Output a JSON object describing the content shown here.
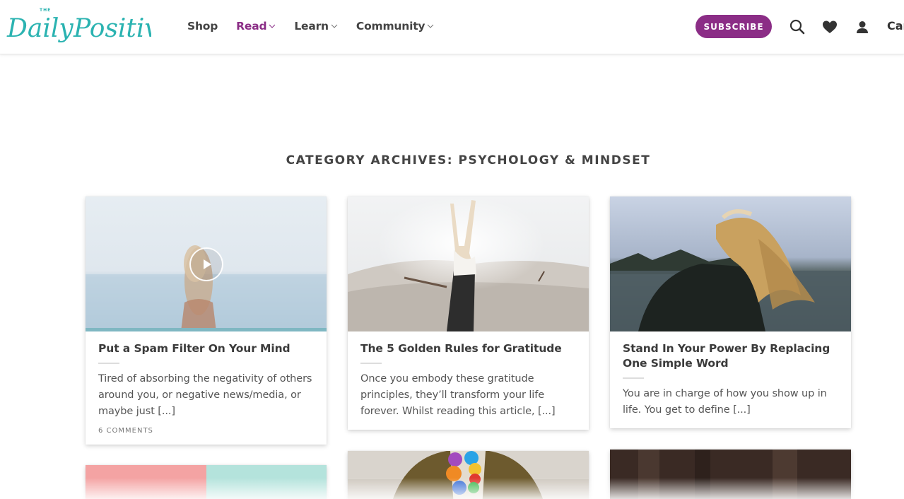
{
  "header": {
    "logo_text": "The Daily Positive",
    "nav": [
      {
        "label": "Shop",
        "has_dropdown": false,
        "active": false
      },
      {
        "label": "Read",
        "has_dropdown": true,
        "active": true
      },
      {
        "label": "Learn",
        "has_dropdown": true,
        "active": false
      },
      {
        "label": "Community",
        "has_dropdown": true,
        "active": false
      }
    ],
    "subscribe_label": "SUBSCRIBE",
    "icons": [
      "search-icon",
      "heart-icon",
      "user-icon"
    ],
    "cart_label": "Car",
    "colors": {
      "accent": "#8b2d86",
      "logo": "#2bb3b1"
    }
  },
  "page_title": "CATEGORY ARCHIVES: PSYCHOLOGY & MINDSET",
  "posts": [
    {
      "title": "Put a Spam Filter On Your Mind",
      "excerpt": "Tired of absorbing the negativity of others around you, or negative news/media, or maybe just [...]",
      "meta": "6 COMMENTS",
      "has_video": true
    },
    {
      "title": "The 5 Golden Rules for Gratitude",
      "excerpt": "Once you embody these gratitude principles, they’ll transform your life forever. Whilst reading this article, [...]",
      "meta": ""
    },
    {
      "title": "Stand In Your Power By Replacing One Simple Word",
      "excerpt": "You are in charge of how you show up in life. You get to define [...]",
      "meta": ""
    }
  ]
}
